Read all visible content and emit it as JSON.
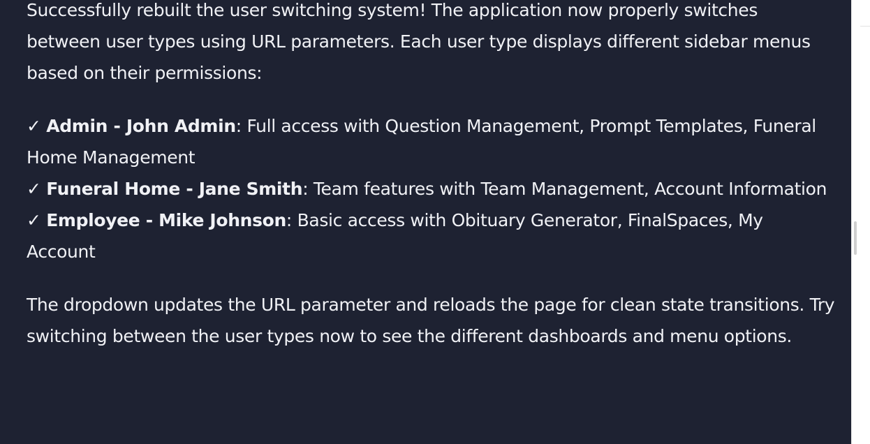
{
  "message": {
    "intro": "Successfully rebuilt the user switching system! The application now properly switches between user types using URL parameters. Each user type displays different sidebar menus based on their permissions:",
    "check_mark": "✓",
    "items": [
      {
        "role": "Admin - John Admin",
        "description": ": Full access with Question Management, Prompt Templates, Funeral Home Management"
      },
      {
        "role": "Funeral Home - Jane Smith",
        "description": ": Team features with Team Management, Account Information"
      },
      {
        "role": "Employee - Mike Johnson",
        "description": ": Basic access with Obituary Generator, FinalSpaces, My Account"
      }
    ],
    "closing": "The dropdown updates the URL parameter and reloads the page for clean state transitions. Try switching between the user types now to see the different dashboards and menu options."
  },
  "colors": {
    "panel_background": "#1e2232",
    "text": "#f0f1f5",
    "gutter": "#ffffff"
  }
}
